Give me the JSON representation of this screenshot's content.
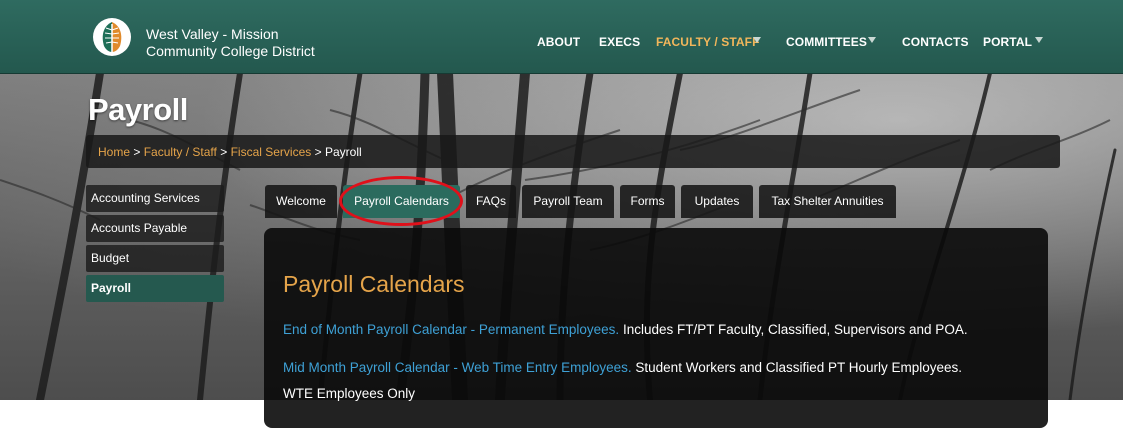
{
  "header": {
    "brand_line1": "West Valley - Mission",
    "brand_line2": "Community College District",
    "nav": [
      {
        "label": "ABOUT"
      },
      {
        "label": "EXECS"
      },
      {
        "label": "FACULTY / STAFF"
      },
      {
        "label": "COMMITTEES"
      },
      {
        "label": "CONTACTS"
      },
      {
        "label": "PORTAL"
      }
    ],
    "accent_color": "#f2b65b",
    "bar_color": "#2a6358"
  },
  "page": {
    "title": "Payroll"
  },
  "breadcrumb": {
    "items": [
      "Home",
      "Faculty / Staff",
      "Fiscal Services"
    ],
    "separator": ">",
    "current": "Payroll"
  },
  "sidebar": {
    "items": [
      {
        "label": "Accounting Services"
      },
      {
        "label": "Accounts Payable"
      },
      {
        "label": "Budget"
      },
      {
        "label": "Payroll"
      }
    ]
  },
  "tabs": [
    {
      "label": "Welcome"
    },
    {
      "label": "Payroll Calendars"
    },
    {
      "label": "FAQs"
    },
    {
      "label": "Payroll Team"
    },
    {
      "label": "Forms"
    },
    {
      "label": "Updates"
    },
    {
      "label": "Tax Shelter Annuities"
    }
  ],
  "content": {
    "heading": "Payroll Calendars",
    "entries": [
      {
        "link": "End of Month Payroll Calendar - Permanent Employees.",
        "text": "Includes FT/PT Faculty, Classified, Supervisors and POA."
      },
      {
        "link": "Mid Month Payroll Calendar - Web Time Entry Employees.",
        "text": "Student Workers and Classified PT Hourly Employees.",
        "text2": "WTE Employees Only"
      }
    ]
  }
}
